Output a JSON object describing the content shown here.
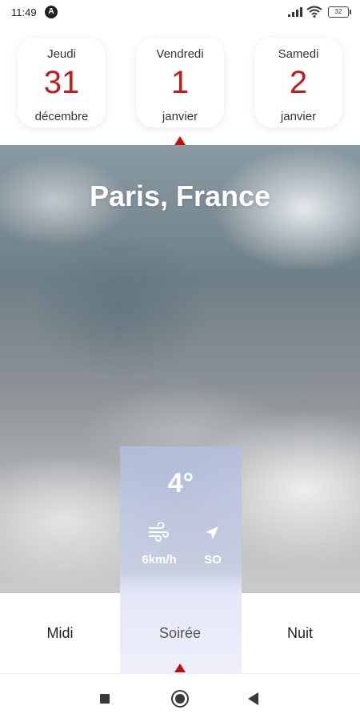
{
  "status_bar": {
    "time": "11:49",
    "battery": "32",
    "alert_icon": "A"
  },
  "days": [
    {
      "weekday": "Jeudi",
      "day": "31",
      "month": "décembre"
    },
    {
      "weekday": "Vendredi",
      "day": "1",
      "month": "janvier",
      "selected": true
    },
    {
      "weekday": "Samedi",
      "day": "2",
      "month": "janvier"
    }
  ],
  "city": "Paris, France",
  "weather": {
    "temperature": "4°",
    "wind_speed": "6km/h",
    "wind_direction": "SO"
  },
  "periods": [
    {
      "label": "Midi"
    },
    {
      "label": "Soirée",
      "selected": true
    },
    {
      "label": "Nuit"
    }
  ],
  "colors": {
    "accent": "#c21b1b",
    "caret": "#c80a0a",
    "highlight": "#e4e7f8"
  },
  "icons": [
    "signal-icon",
    "wifi-icon",
    "battery-icon",
    "wind-icon",
    "direction-arrow-icon",
    "recent-apps-icon",
    "home-icon",
    "back-icon"
  ]
}
